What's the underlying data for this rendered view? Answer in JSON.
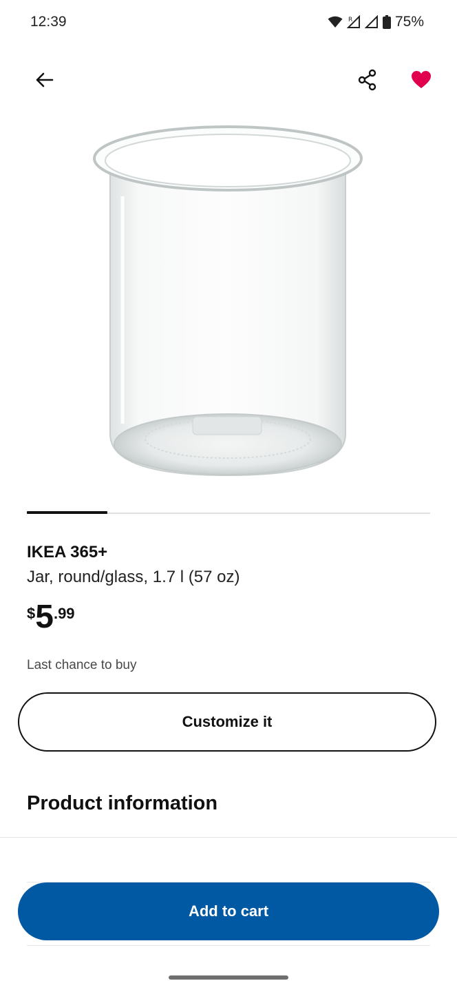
{
  "status_bar": {
    "time": "12:39",
    "battery": "75%",
    "icons": [
      "wifi-icon",
      "signal-roaming-icon",
      "signal-icon",
      "battery-icon"
    ]
  },
  "nav": {
    "icons": [
      "arrow-left-icon",
      "share-icon",
      "heart-filled-icon"
    ],
    "favorite_color": "#e0004d"
  },
  "product": {
    "name": "IKEA 365+",
    "description": "Jar, round/glass, 1.7 l (57 oz)",
    "price": {
      "currency": "$",
      "integer": "5",
      "decimal": ".99"
    },
    "availability": "Last chance to buy"
  },
  "carousel": {
    "current_index": 1,
    "total": 5
  },
  "buttons": {
    "customize": "Customize it",
    "add_to_cart": "Add to cart"
  },
  "sections": {
    "product_information": "Product information"
  },
  "colors": {
    "primary": "#0158a3",
    "text": "#111111"
  }
}
